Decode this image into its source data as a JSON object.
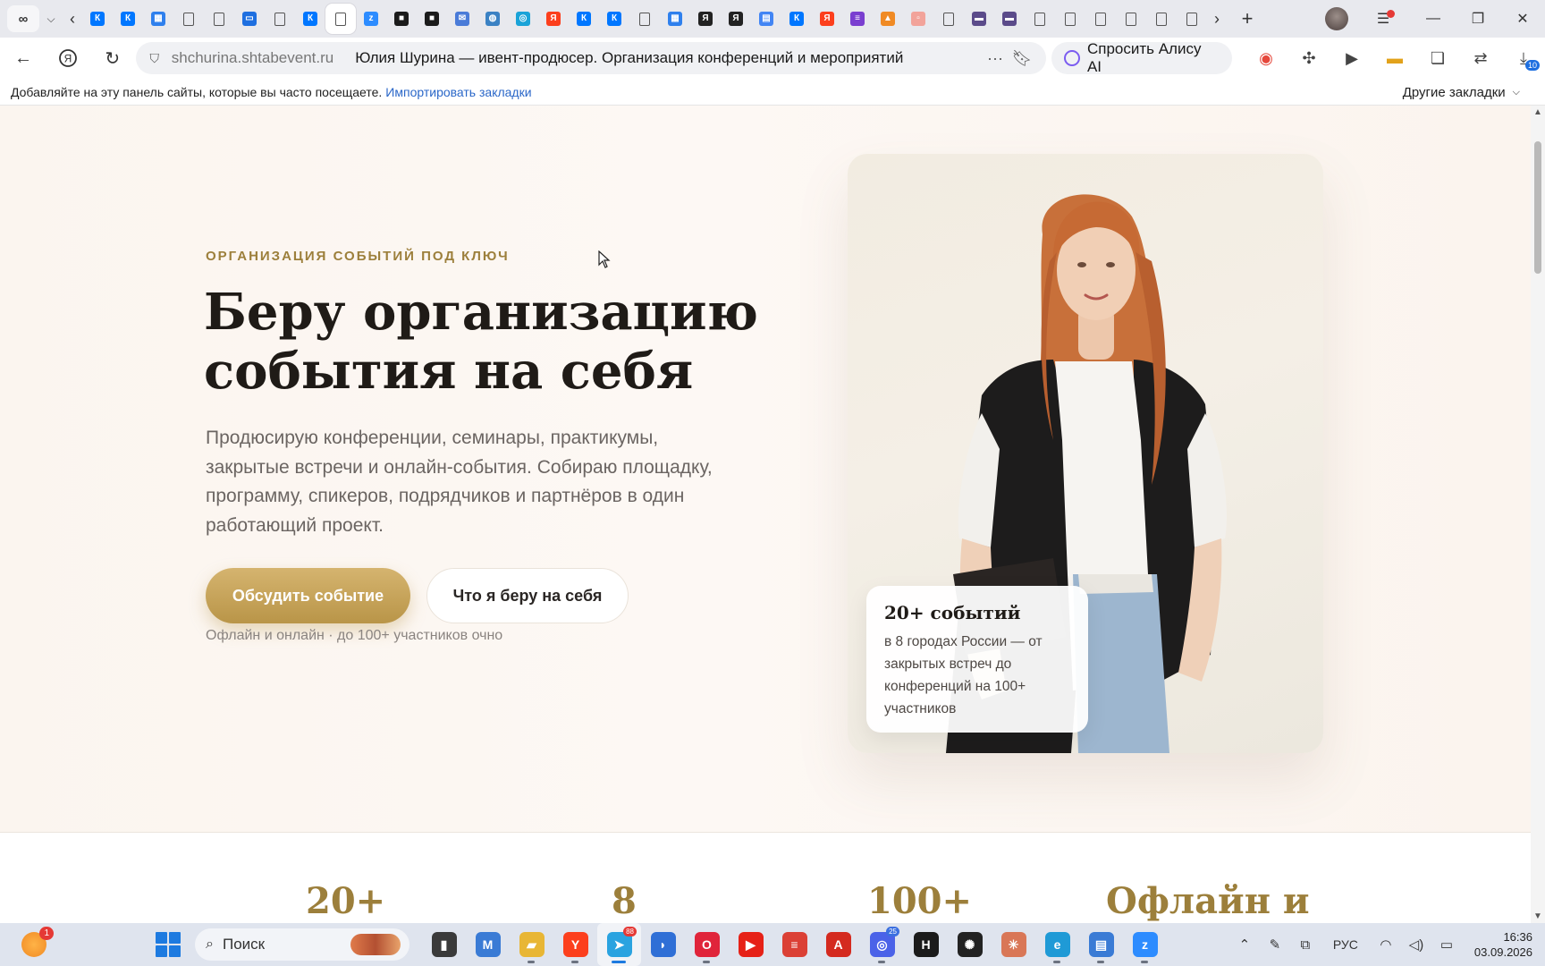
{
  "browser": {
    "tabs": [
      {
        "icon": "vk-icon",
        "color": "#0077ff",
        "glyph": "К"
      },
      {
        "icon": "vk-icon",
        "color": "#0077ff",
        "glyph": "К"
      },
      {
        "icon": "grid-app-icon",
        "color": "#2f80ed",
        "glyph": "▦"
      },
      {
        "icon": "document-icon",
        "color": "",
        "glyph": ""
      },
      {
        "icon": "document-icon",
        "color": "",
        "glyph": ""
      },
      {
        "icon": "chat-icon",
        "color": "#1e6fe0",
        "glyph": "▭"
      },
      {
        "icon": "document-icon",
        "color": "",
        "glyph": ""
      },
      {
        "icon": "vk-icon",
        "color": "#0077ff",
        "glyph": "К"
      },
      {
        "icon": "document-icon",
        "color": "",
        "glyph": "",
        "active": true
      },
      {
        "icon": "zoom-icon",
        "color": "#2d8cff",
        "glyph": "z"
      },
      {
        "icon": "dark-app-icon",
        "color": "#1b1b1b",
        "glyph": "■"
      },
      {
        "icon": "dark-app-icon",
        "color": "#1b1b1b",
        "glyph": "■"
      },
      {
        "icon": "mail-icon",
        "color": "#4a7bd8",
        "glyph": "✉"
      },
      {
        "icon": "globe-icon",
        "color": "#3b82c4",
        "glyph": "◍"
      },
      {
        "icon": "browser-app-icon",
        "color": "#1aa3d8",
        "glyph": "◎"
      },
      {
        "icon": "yandex-icon",
        "color": "#fc3f1d",
        "glyph": "Я"
      },
      {
        "icon": "vk-icon",
        "color": "#0077ff",
        "glyph": "К"
      },
      {
        "icon": "vk-icon",
        "color": "#0077ff",
        "glyph": "К"
      },
      {
        "icon": "document-icon",
        "color": "",
        "glyph": ""
      },
      {
        "icon": "grid-app-icon",
        "color": "#2f80ed",
        "glyph": "▦"
      },
      {
        "icon": "yandex-icon",
        "color": "#222222",
        "glyph": "Я"
      },
      {
        "icon": "yandex-icon",
        "color": "#222222",
        "glyph": "Я"
      },
      {
        "icon": "docs-icon",
        "color": "#4285f4",
        "glyph": "▤"
      },
      {
        "icon": "vk-icon",
        "color": "#0077ff",
        "glyph": "К"
      },
      {
        "icon": "yandex-icon",
        "color": "#fc3f1d",
        "glyph": "Я"
      },
      {
        "icon": "stripes-icon",
        "color": "#7a3fd0",
        "glyph": "≡"
      },
      {
        "icon": "fox-icon",
        "color": "#f08a24",
        "glyph": "▲"
      },
      {
        "icon": "pdf-icon",
        "color": "#f2a39a",
        "glyph": "▫"
      },
      {
        "icon": "document-icon",
        "color": "",
        "glyph": ""
      },
      {
        "icon": "media-icon",
        "color": "#5b4b8a",
        "glyph": "▬"
      },
      {
        "icon": "media-icon",
        "color": "#5b4b8a",
        "glyph": "▬"
      },
      {
        "icon": "document-icon",
        "color": "",
        "glyph": ""
      },
      {
        "icon": "document-icon",
        "color": "",
        "glyph": ""
      },
      {
        "icon": "document-icon",
        "color": "",
        "glyph": ""
      },
      {
        "icon": "document-icon",
        "color": "",
        "glyph": ""
      },
      {
        "icon": "document-icon",
        "color": "",
        "glyph": ""
      },
      {
        "icon": "document-icon",
        "color": "",
        "glyph": ""
      }
    ],
    "address": {
      "domain": "shchurina.shtabevent.ru",
      "title": "Юлия Шурина — ивент-продюсер. Организация конференций и мероприятий"
    },
    "alisa_label": "Спросить Алису AI",
    "extensions": [
      {
        "icon": "record-icon",
        "badge": ""
      },
      {
        "icon": "puzzle-icon",
        "badge": ""
      },
      {
        "icon": "play-icon",
        "badge": ""
      },
      {
        "icon": "battery-icon",
        "badge": ""
      },
      {
        "icon": "collections-icon",
        "badge": ""
      },
      {
        "icon": "translate-icon",
        "badge": ""
      },
      {
        "icon": "downloads-icon",
        "badge": "10"
      }
    ],
    "bookmarks": {
      "hint": "Добавляйте на эту панель сайты, которые вы часто посещаете.",
      "import_link": "Импортировать закладки",
      "other": "Другие закладки"
    }
  },
  "hero": {
    "eyebrow": "ОРГАНИЗАЦИЯ СОБЫТИЙ ПОД КЛЮЧ",
    "headline_line1": "Беру организацию",
    "headline_line2": "события на себя",
    "lead": "Продюсирую конференции, семинары, практикумы, закрытые встречи и онлайн-события. Собираю площадку, программу, спикеров, подрядчиков и партнёров в один работающий проект.",
    "primary_cta": "Обсудить событие",
    "secondary_cta": "Что я беру на себя",
    "note": "Офлайн и онлайн · до 100+ участников очно",
    "info_card": {
      "title": "20+ событий",
      "text": "в 8 городах России — от закрытых встреч до конференций на 100+ участников"
    }
  },
  "stats": [
    "20+",
    "8",
    "100+",
    "Офлайн и"
  ],
  "colors": {
    "accent_gold": "#b99548",
    "eyebrow_gold": "#9c7f3b",
    "page_bg": "#fbf5ef"
  },
  "taskbar": {
    "weather_badge": "1",
    "search_placeholder": "Поиск",
    "apps": [
      {
        "icon": "file-explorer-dark-icon",
        "color": "#3a3a3a",
        "glyph": "▮",
        "run": false
      },
      {
        "icon": "m365-icon",
        "color": "#3a7bd5",
        "glyph": "M",
        "run": false
      },
      {
        "icon": "folder-icon",
        "color": "#e8b635",
        "glyph": "▰",
        "run": true
      },
      {
        "icon": "yandex-browser-icon",
        "color": "#fc3f1d",
        "glyph": "Y",
        "run": true
      },
      {
        "icon": "telegram-icon",
        "color": "#2aa3e0",
        "glyph": "➤",
        "run": false,
        "active": true,
        "count": "88"
      },
      {
        "icon": "cloud-icon",
        "color": "#2f6fd6",
        "glyph": "◗",
        "run": false
      },
      {
        "icon": "opera-icon",
        "color": "#e0243a",
        "glyph": "O",
        "run": true
      },
      {
        "icon": "youtube-icon",
        "color": "#e62117",
        "glyph": "▶",
        "run": false
      },
      {
        "icon": "todoist-icon",
        "color": "#db4035",
        "glyph": "≡",
        "run": false
      },
      {
        "icon": "pdf-reader-icon",
        "color": "#d42a1f",
        "glyph": "A",
        "run": false
      },
      {
        "icon": "max-messenger-icon",
        "color": "#4b62e8",
        "glyph": "◎",
        "run": true,
        "count": "25",
        "countBlue": true
      },
      {
        "icon": "notion-icon",
        "color": "#1b1b1b",
        "glyph": "H",
        "run": false
      },
      {
        "icon": "chatgpt-icon",
        "color": "#222222",
        "glyph": "✺",
        "run": false
      },
      {
        "icon": "claude-icon",
        "color": "#d97757",
        "glyph": "✳",
        "run": false
      },
      {
        "icon": "edge-icon",
        "color": "#1f9ad6",
        "glyph": "e",
        "run": true
      },
      {
        "icon": "notepad-icon",
        "color": "#3a7bd5",
        "glyph": "▤",
        "run": true
      },
      {
        "icon": "zoom-icon",
        "color": "#2d8cff",
        "glyph": "z",
        "run": true
      }
    ],
    "tray_lang": "РУС",
    "time": "16:36",
    "date": "03.09.2026"
  }
}
